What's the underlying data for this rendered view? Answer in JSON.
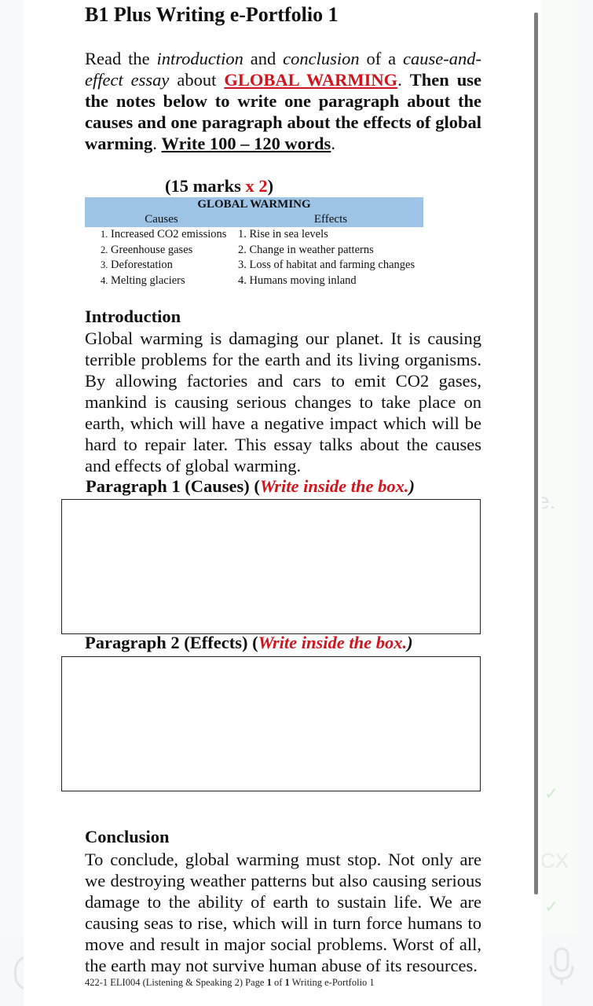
{
  "document": {
    "title": "B1 Plus Writing e-Portfolio 1",
    "instructions": {
      "part1": "Read the ",
      "introduction_word": "introduction",
      "part2": " and ",
      "conclusion_word": "conclusion",
      "part3": " of a ",
      "essay_type": "cause-and-effect essay",
      "part4": " about ",
      "topic": "GLOBAL WARMING",
      "part5": ". ",
      "bold_instruction": "Then use the notes below to write one paragraph about the causes and one paragraph about the effects of global warming",
      "part6": ". ",
      "word_count": "Write 100 – 120 words",
      "part7": "."
    },
    "marks": {
      "open": "(15 marks ",
      "multiplier": "x 2",
      "close": ")"
    },
    "notes_table": {
      "title": "GLOBAL WARMING",
      "headers": [
        "Causes",
        "Effects"
      ],
      "rows": [
        {
          "cause_num": "1.",
          "cause": "Increased CO2 emissions",
          "effect_num": "1.",
          "effect": "Rise in sea levels"
        },
        {
          "cause_num": "2.",
          "cause": "Greenhouse gases",
          "effect_num": "2.",
          "effect": "Change in weather patterns"
        },
        {
          "cause_num": "3.",
          "cause": "Deforestation",
          "effect_num": "3.",
          "effect": "Loss of habitat and farming changes"
        },
        {
          "cause_num": "4.",
          "cause": "Melting glaciers",
          "effect_num": "4.",
          "effect": "Humans moving inland"
        }
      ]
    },
    "introduction": {
      "heading": "Introduction",
      "text": "Global warming is damaging our planet. It is causing terrible problems for the earth and its living organisms. By allowing factories and cars to emit CO2 gases, mankind is causing serious changes to take place on earth, which will have a negative impact which will be hard to repair later. This essay talks about the causes and effects of global warming."
    },
    "paragraph1": {
      "label": "Paragraph 1 (Causes) (",
      "hint": "Write inside the box.",
      "close": ")",
      "value": ""
    },
    "paragraph2": {
      "label": "Paragraph 2 (Effects) (",
      "hint": "Write inside the box.",
      "close": ")",
      "value": ""
    },
    "conclusion": {
      "heading": "Conclusion",
      "text": "To conclude, global warming must stop. Not only are we destroying weather patterns but also causing serious damage to the ability of earth to sustain life.  We are causing seas to rise, which will in turn force humans to move and result in major social problems. Worst of all, the earth may not survive human abuse of its resources."
    },
    "footer": {
      "course": "422-1  ELI004 (Listening & Speaking 2) Page ",
      "page": "1",
      "of": " of ",
      "total": "1",
      "doc": "  Writing e-Portfolio 1"
    }
  },
  "background_app": {
    "ghost_text_1": "e.",
    "ghost_text_2": "CX",
    "icons": [
      "check-icon",
      "check-icon",
      "microphone-icon"
    ]
  },
  "colors": {
    "accent_red": "#d4141c",
    "table_header_blue": "#9dc3e6"
  }
}
